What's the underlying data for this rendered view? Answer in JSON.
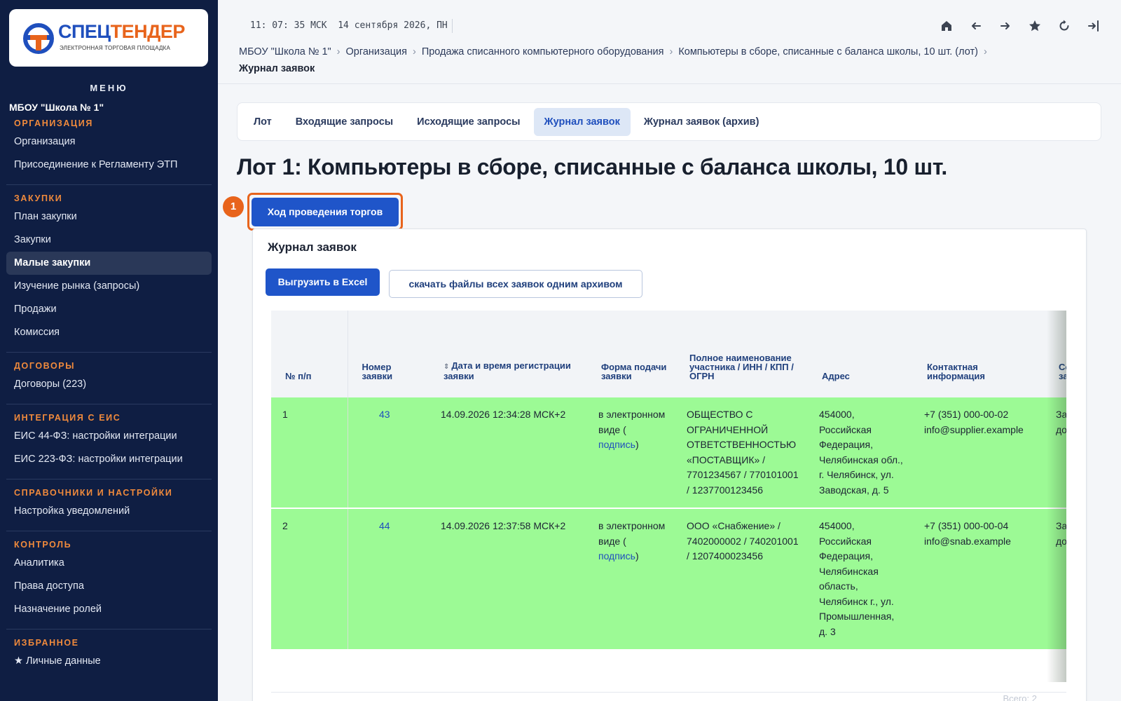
{
  "logo": {
    "word_part1": "СПЕЦ",
    "word_part2": "ТЕНДЕР",
    "subtitle": "ЭЛЕКТРОННАЯ ТОРГОВАЯ ПЛОЩАДКА",
    "brand_blue": "#1f4fbd",
    "brand_orange": "#e8641c"
  },
  "sidebar": {
    "menu_title": "МЕНЮ",
    "org_name": "МБОУ \"Школа № 1\"",
    "sections": [
      {
        "title": "ОРГАНИЗАЦИЯ",
        "items": [
          {
            "label": "Организация",
            "active": false
          },
          {
            "label": "Присоединение к Регламенту ЭТП",
            "active": false
          }
        ]
      },
      {
        "title": "ЗАКУПКИ",
        "items": [
          {
            "label": "План закупки",
            "active": false
          },
          {
            "label": "Закупки",
            "active": false
          },
          {
            "label": "Малые закупки",
            "active": true
          },
          {
            "label": "Изучение рынка (запросы)",
            "active": false
          },
          {
            "label": "Продажи",
            "active": false
          },
          {
            "label": "Комиссия",
            "active": false
          }
        ]
      },
      {
        "title": "ДОГОВОРЫ",
        "items": [
          {
            "label": "Договоры (223)",
            "active": false
          }
        ]
      },
      {
        "title": "ИНТЕГРАЦИЯ С ЕИС",
        "items": [
          {
            "label": "ЕИС 44-ФЗ: настройки интеграции",
            "active": false
          },
          {
            "label": "ЕИС 223-ФЗ: настройки интеграции",
            "active": false
          }
        ]
      },
      {
        "title": "СПРАВОЧНИКИ И НАСТРОЙКИ",
        "items": [
          {
            "label": "Настройка уведомлений",
            "active": false
          }
        ]
      },
      {
        "title": "КОНТРОЛЬ",
        "items": [
          {
            "label": "Аналитика",
            "active": false
          },
          {
            "label": "Права доступа",
            "active": false
          },
          {
            "label": "Назначение ролей",
            "active": false
          }
        ]
      },
      {
        "title": "ИЗБРАННОЕ",
        "items": [
          {
            "label": "★ Личные данные",
            "active": false
          }
        ]
      }
    ]
  },
  "header": {
    "clock": "11: 07: 35 МСК  14 сентября 2026, ПН",
    "icons": [
      "home-icon",
      "arrow-left-icon",
      "arrow-right-icon",
      "star-icon",
      "refresh-icon",
      "logout-icon"
    ],
    "breadcrumb": [
      "МБОУ \"Школа № 1\"",
      "Организация",
      "Продажа списанного компьютерного оборудования",
      "Компьютеры в сборе, списанные с баланса школы, 10 шт. (лот)"
    ],
    "breadcrumb_separator": "›",
    "breadcrumb_current": "Журнал заявок"
  },
  "tabs": [
    {
      "label": "Лот",
      "active": false
    },
    {
      "label": "Входящие запросы",
      "active": false
    },
    {
      "label": "Исходящие запросы",
      "active": false
    },
    {
      "label": "Журнал заявок",
      "active": true
    },
    {
      "label": "Журнал заявок (архив)",
      "active": false
    }
  ],
  "lot_title": "Лот 1: Компьютеры в сборе, списанные с баланса школы, 10 шт.",
  "step_badge": "1",
  "auction_button": "Ход проведения торгов",
  "journal": {
    "title": "Журнал заявок",
    "export_button": "Выгрузить в Excel",
    "download_button": "скачать файлы всех заявок одним архивом",
    "columns": [
      "№ п/п",
      "Номер заявки",
      "Дата и время регистрации заявки",
      "Форма подачи заявки",
      "Полное наименование участника / ИНН / КПП / ОГРН",
      "Адрес",
      "Контактная информация",
      "Состояние заявки"
    ],
    "rows": [
      {
        "index": "1",
        "number": "43",
        "datetime": "14.09.2026 12:34:28 МСК+2",
        "form_text": "в электронном виде (",
        "form_link": "подпись",
        "form_close": ")",
        "participant": "ОБЩЕСТВО С ОГРАНИЧЕННОЙ ОТВЕТСТВЕННОСТЬЮ «ПОСТАВЩИК» / 7701234567 / 770101001 / 1237700123456",
        "address": "454000, Российская Федерация, Челябинская обл., г. Челябинск, ул. Заводская, д. 5",
        "phone": "+7 (351) 000-00-02",
        "email": "info@supplier.example",
        "status": "Заявка допущена"
      },
      {
        "index": "2",
        "number": "44",
        "datetime": "14.09.2026 12:37:58 МСК+2",
        "form_text": "в электронном виде (",
        "form_link": "подпись",
        "form_close": ")",
        "participant": "ООО «Снабжение» / 7402000002 / 740201001 / 1207400023456",
        "address": "454000, Российская Федерация, Челябинская область, Челябинск г., ул. Промышленная, д. 3",
        "phone": "+7 (351) 000-00-04",
        "email": "info@snab.example",
        "status": "Заявка допущена"
      }
    ],
    "row_color": "#9cfa95",
    "total": "Всего: 2"
  }
}
